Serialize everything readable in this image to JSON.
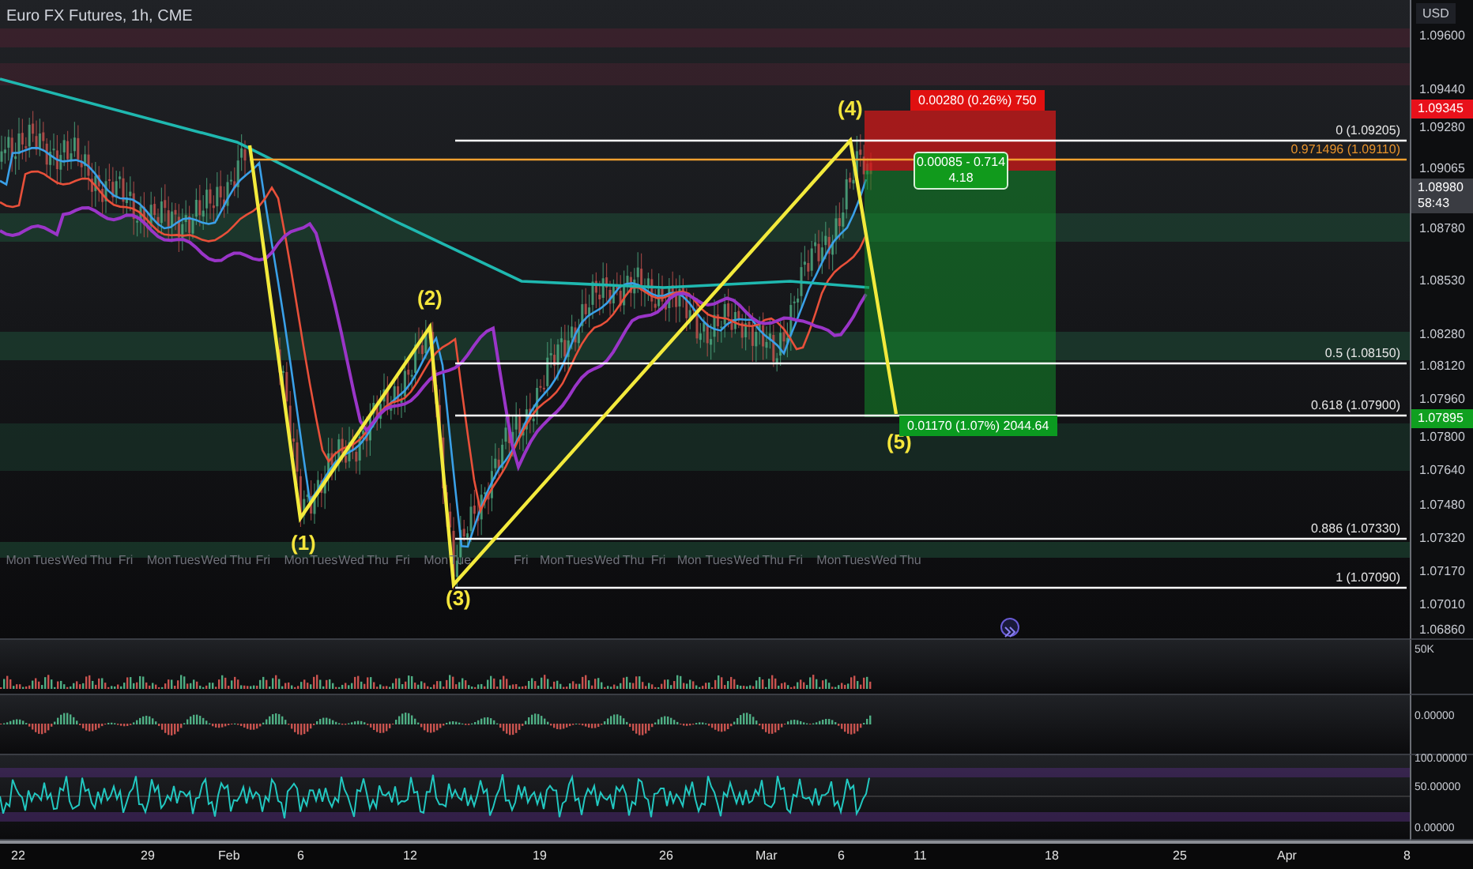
{
  "header": {
    "title": "Euro FX Futures, 1h, CME"
  },
  "weekdays": [
    "Mon",
    "Tues",
    "Wed",
    "Thu",
    "Fri",
    "Mon",
    "Tues",
    "Wed",
    "Thu",
    "Fri",
    "Mon",
    "Tues",
    "Wed",
    "Thu",
    "Fri",
    "Mon",
    "Tue",
    "Fri",
    "Mon",
    "Tues",
    "Wed",
    "Thu",
    "Fri",
    "Mon",
    "Tues",
    "Wed",
    "Thu",
    "Fri",
    "Mon",
    "Tues",
    "Wed",
    "Thu"
  ],
  "waves": [
    "(1)",
    "(2)",
    "(3)",
    "(4)",
    "(5)"
  ],
  "fib_levels": [
    {
      "label": "0 (1.09205)",
      "kind": "fib"
    },
    {
      "label": "0.971496 (1.09110)",
      "kind": "level"
    },
    {
      "label": "0.5 (1.08150)",
      "kind": "fib"
    },
    {
      "label": "0.618 (1.07900)",
      "kind": "fib"
    },
    {
      "label": "0.886 (1.07330)",
      "kind": "fib"
    },
    {
      "label": "1 (1.07090)",
      "kind": "fib"
    }
  ],
  "position": {
    "risk": "0.00280 (0.26%) 750",
    "entry": [
      "0.00085 - 0.714",
      "4.18"
    ],
    "reward": "0.01170 (1.07%) 2044.64"
  },
  "price_axis": {
    "currency": "USD",
    "labels": [
      "1.09600",
      "1.09440",
      "1.09280",
      "1.09065",
      "1.08780",
      "1.08530",
      "1.08280",
      "1.08120",
      "1.07960",
      "1.07800",
      "1.07640",
      "1.07480",
      "1.07320",
      "1.07170",
      "1.07010",
      "1.06860"
    ],
    "badges": [
      {
        "kind": "loss",
        "lines": [
          "1.09345"
        ]
      },
      {
        "kind": "last",
        "lines": [
          "1.08980",
          "58:43"
        ]
      },
      {
        "kind": "target",
        "lines": [
          "1.07895"
        ]
      }
    ]
  },
  "volume_axis": [
    "50K"
  ],
  "macd_axis": [
    "0.00000"
  ],
  "rsi_axis": [
    "100.00000",
    "50.00000",
    "0.00000"
  ],
  "time_axis": [
    "22",
    "29",
    "Feb",
    "6",
    "12",
    "19",
    "26",
    "Mar",
    "6",
    "11",
    "18",
    "25",
    "Apr",
    "8"
  ]
}
